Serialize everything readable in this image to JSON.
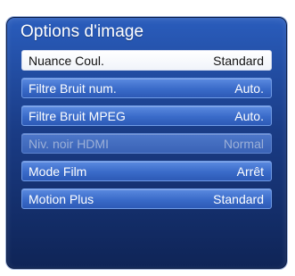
{
  "panel": {
    "title": "Options d'image"
  },
  "menu": {
    "items": [
      {
        "label": "Nuance Coul.",
        "value": "Standard"
      },
      {
        "label": "Filtre Bruit num.",
        "value": "Auto."
      },
      {
        "label": "Filtre Bruit MPEG",
        "value": "Auto."
      },
      {
        "label": "Niv. noir HDMI",
        "value": "Normal"
      },
      {
        "label": "Mode Film",
        "value": "Arrêt"
      },
      {
        "label": "Motion Plus",
        "value": "Standard"
      }
    ]
  },
  "colors": {
    "panel_top": "#2a5dbd",
    "panel_bottom": "#0f2456",
    "item_bg": "#3a6bc9",
    "selected_bg": "#ffffff",
    "disabled_text": "#9cb0d8"
  }
}
